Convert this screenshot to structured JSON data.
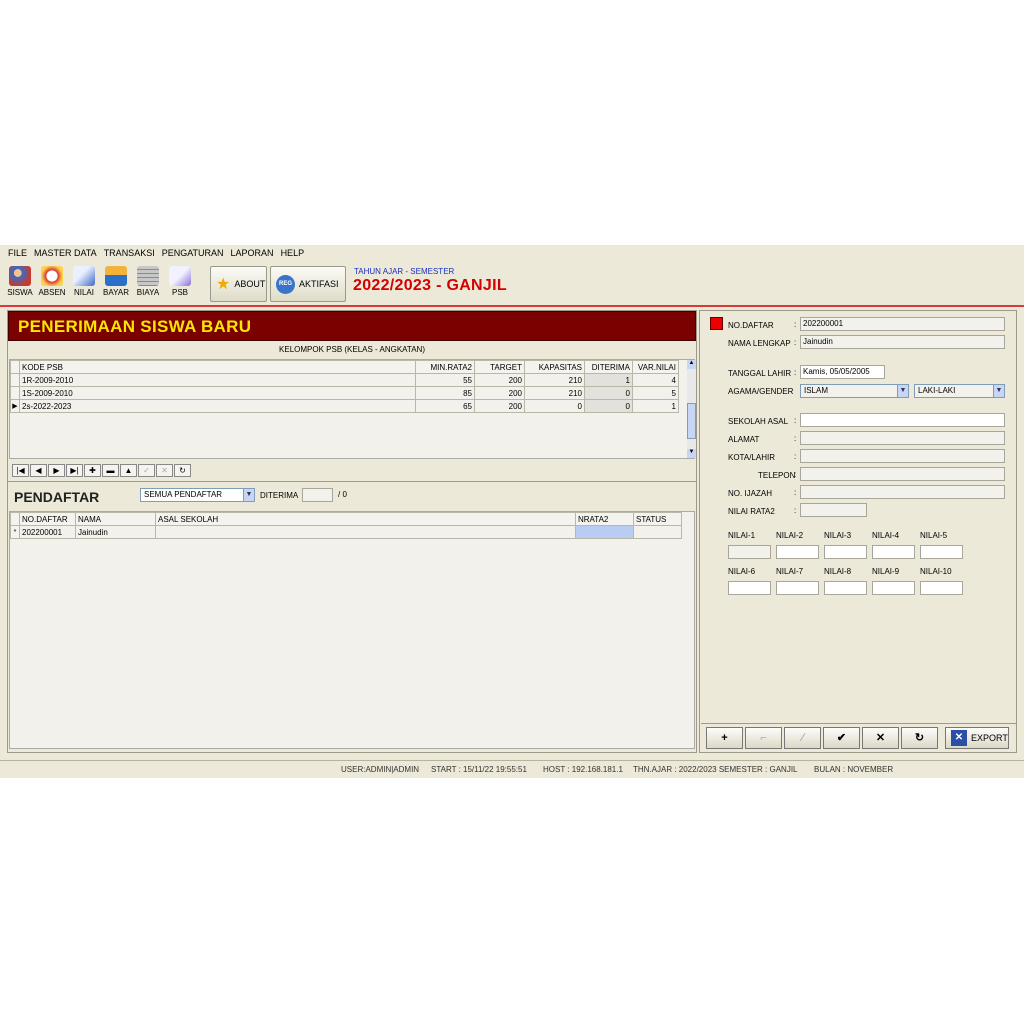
{
  "menu": [
    "FILE",
    "MASTER DATA",
    "TRANSAKSI",
    "PENGATURAN",
    "LAPORAN",
    "HELP"
  ],
  "toolbar": {
    "siswa": "SISWA",
    "absen": "ABSEN",
    "nilai": "NILAI",
    "bayar": "BAYAR",
    "biaya": "BIAYA",
    "psb": "PSB",
    "about": "ABOUT",
    "reg_icon": "REG",
    "aktifasi": "AKTIFASI",
    "year_label": "TAHUN AJAR - SEMESTER",
    "year_value": "2022/2023 - GANJIL"
  },
  "banner": "PENERIMAAN SISWA BARU",
  "group_title": "KELOMPOK PSB  (KELAS - ANGKATAN)",
  "grid1": {
    "headers": [
      "KODE PSB",
      "MIN.RATA2",
      "TARGET",
      "KAPASITAS",
      "DITERIMA",
      "VAR.NILAI"
    ],
    "rows": [
      [
        "1R-2009-2010",
        "55",
        "200",
        "210",
        "1",
        "4"
      ],
      [
        "1S-2009-2010",
        "85",
        "200",
        "210",
        "0",
        "5"
      ],
      [
        "2s-2022-2023",
        "65",
        "200",
        "0",
        "0",
        "1"
      ]
    ]
  },
  "pendaftar": {
    "title": "PENDAFTAR",
    "filter": "SEMUA PENDAFTAR",
    "diterima_label": "DITERIMA",
    "diterima_value": "",
    "total": "/ 0"
  },
  "grid2": {
    "headers": [
      "NO.DAFTAR",
      "NAMA",
      "ASAL SEKOLAH",
      "NRATA2",
      "STATUS"
    ],
    "rows": [
      [
        "202200001",
        "Jainudin",
        "",
        "",
        ""
      ]
    ]
  },
  "form": {
    "no_daftar_label": "NO.DAFTAR",
    "no_daftar": "202200001",
    "nama_label": "NAMA LENGKAP",
    "nama": "Jainudin",
    "tgl_label": "TANGGAL LAHIR",
    "tgl": "Kamis, 05/05/2005",
    "agama_label": "AGAMA/GENDER",
    "agama": "ISLAM",
    "gender": "LAKI-LAKI",
    "sekolah_label": "SEKOLAH ASAL",
    "alamat_label": "ALAMAT",
    "kota_label": "KOTA/LAHIR",
    "telepon_label": "TELEPON",
    "ijazah_label": "NO. IJAZAH",
    "rata_label": "NILAI RATA2",
    "nilai": [
      "NILAI-1",
      "NILAI-2",
      "NILAI-3",
      "NILAI-4",
      "NILAI-5",
      "NILAI-6",
      "NILAI-7",
      "NILAI-8",
      "NILAI-9",
      "NILAI-10"
    ],
    "export": "EXPORT"
  },
  "status": {
    "user": "USER:ADMIN|ADMIN",
    "start": "START : 15/11/22 19:55:51",
    "host": "HOST : 192.168.181.1",
    "thn": "THN.AJAR : 2022/2023 SEMESTER : GANJIL",
    "bulan": "BULAN : NOVEMBER"
  },
  "colors": {
    "banner": "#7b0000",
    "banner_text": "#ffe600",
    "year": "#d40000"
  }
}
